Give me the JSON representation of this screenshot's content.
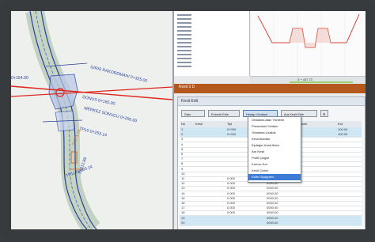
{
  "cad": {
    "labels": [
      "GIRIS RAKORDMANI 0+325.00",
      "0+154.00",
      "DONUS 0+165.00",
      "MERKEZ SONUCU 0+200.00",
      "TP10 0+253.14",
      "0+271.24",
      "0+312.89",
      "TP11 0+303.14"
    ]
  },
  "right_pane": {
    "chart_caption": "3 + 437.72",
    "orange_bar_text": "Kesit 3 D"
  },
  "dialog": {
    "title": "Kesit Edit",
    "toolbar": [
      "Satır",
      "Enkesit Ekle",
      "Hesap Yöntemi",
      "Ara Kesit Ekle"
    ],
    "columns": [
      "No",
      "Kesit",
      "Tipi",
      "Alan",
      "Hacim",
      "Kot"
    ],
    "rows": [
      {
        "no": "1",
        "km": "0+000",
        "val": "0.000",
        "kot": "100.00"
      },
      {
        "no": "2",
        "km": "0+020",
        "val": "",
        "kot": "100.00"
      },
      {
        "no": "3",
        "km": "",
        "val": "",
        "kot": ""
      },
      {
        "no": "4",
        "km": "",
        "val": "",
        "kot": ""
      },
      {
        "no": "5",
        "km": "",
        "val": "",
        "kot": ""
      },
      {
        "no": "6",
        "km": "",
        "val": "",
        "kot": ""
      },
      {
        "no": "7",
        "km": "",
        "val": "",
        "kot": ""
      },
      {
        "no": "8",
        "km": "",
        "val": "",
        "kot": ""
      },
      {
        "no": "9",
        "km": "",
        "val": "",
        "kot": ""
      },
      {
        "no": "10",
        "km": "",
        "val": "",
        "kot": ""
      },
      {
        "no": "11",
        "km": "0.000",
        "val": "0000.00",
        "kot": ""
      },
      {
        "no": "12",
        "km": "0.000",
        "val": "0000.00",
        "kot": ""
      },
      {
        "no": "13",
        "km": "0.000",
        "val": "0000.00",
        "kot": ""
      },
      {
        "no": "14",
        "km": "0.000",
        "val": "0000.00",
        "kot": ""
      },
      {
        "no": "15",
        "km": "0.000",
        "val": "0000.00",
        "kot": ""
      },
      {
        "no": "16",
        "km": "0.000",
        "val": "0000.00",
        "kot": ""
      },
      {
        "no": "17",
        "km": "0.000",
        "val": "0000.00",
        "kot": ""
      },
      {
        "no": "18",
        "km": "0.000",
        "val": "0000.00",
        "kot": ""
      },
      {
        "no": "19",
        "km": "",
        "val": "0000.00",
        "kot": ""
      },
      {
        "no": "20",
        "km": "",
        "val": "0000.00",
        "kot": ""
      }
    ],
    "menu": [
      "Ortalama Alan Yöntemi",
      "Prizmoidal Yöntem",
      "Ortalama Uzaklık",
      "Kesit Alanları",
      "Eşdeğer Kesit Alanı",
      "Ara Kesit",
      "Profil Çizgisi",
      "Kırmızı Kot",
      "Kesit Çizimi",
      "Kütle Diyagramı"
    ],
    "menu_selected_index": 9
  },
  "colors": {
    "accent": "#3e7bd6",
    "orange": "#b5581e",
    "road_blue": "#2a3f9a",
    "red_axis": "#e0261c"
  }
}
